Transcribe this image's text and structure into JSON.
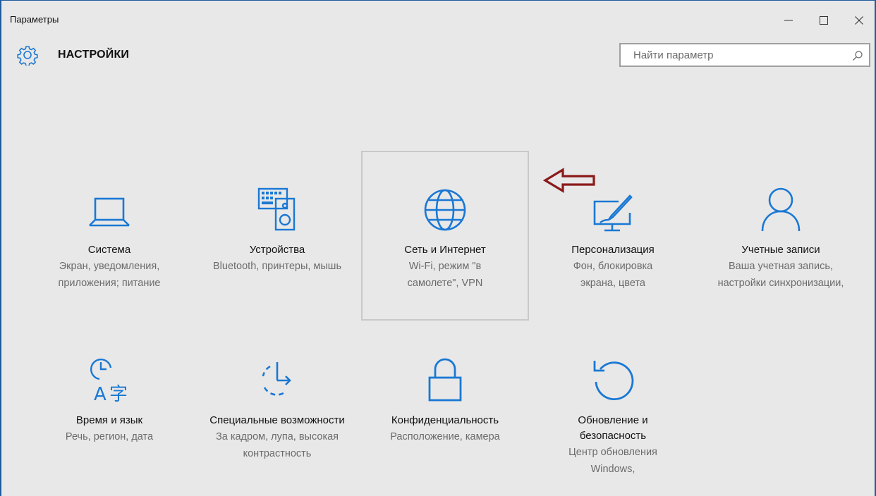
{
  "window": {
    "title": "Параметры"
  },
  "header": {
    "title": "НАСТРОЙКИ"
  },
  "search": {
    "placeholder": "Найти параметр"
  },
  "accent_color": "#1a78d4",
  "arrow_color": "#8b1a1a",
  "tiles": [
    {
      "icon": "laptop-icon",
      "name": "Система",
      "desc": "Экран, уведомления, приложения; питание"
    },
    {
      "icon": "devices-icon",
      "name": "Устройства",
      "desc": "Bluetooth, принтеры, мышь"
    },
    {
      "icon": "globe-icon",
      "name": "Сеть и Интернет",
      "desc": "Wi-Fi, режим \"в самолете\", VPN"
    },
    {
      "icon": "personalization-icon",
      "name": "Персонализация",
      "desc": "Фон, блокировка экрана, цвета"
    },
    {
      "icon": "person-icon",
      "name": "Учетные записи",
      "desc": "Ваша учетная запись, настройки синхронизации,"
    },
    {
      "icon": "time-language-icon",
      "name": "Время и язык",
      "desc": "Речь, регион, дата"
    },
    {
      "icon": "accessibility-icon",
      "name": "Специальные возможности",
      "desc": "За кадром, лупа, высокая контрастность"
    },
    {
      "icon": "lock-icon",
      "name": "Конфиденциальность",
      "desc": "Расположение, камера"
    },
    {
      "icon": "update-icon",
      "name": "Обновление и безопасность",
      "desc": "Центр обновления Windows,"
    }
  ]
}
